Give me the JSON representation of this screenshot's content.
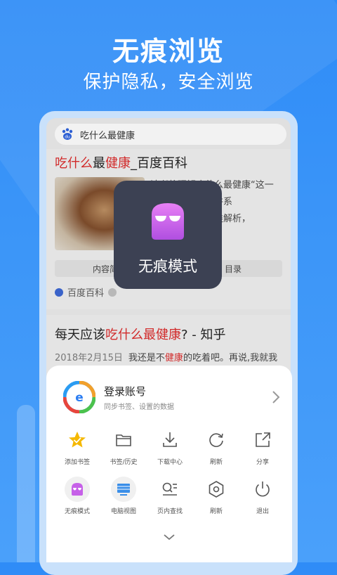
{
  "hero": {
    "headline": "无痕浏览",
    "subline": "保护隐私，安全浏览"
  },
  "search": {
    "query": "吃什么最健康"
  },
  "result1": {
    "title_a": "吃什么",
    "title_b": "最",
    "title_c": "健康",
    "title_d": "_百度百科",
    "snippet_lines": [
      "读者将理解吃什么最健康“这一",
      "问题展开论述，并系",
      "统地做了食物分类解析，",
      "对常见疾病做了..."
    ],
    "pills": [
      "内容简介",
      "目录"
    ],
    "source": "百度百科"
  },
  "result2": {
    "title_a": "每天应该",
    "title_b": "吃什么最健康",
    "title_c": "? - 知乎",
    "date": "2018年2月15日",
    "text_a": "我还是不",
    "text_b": "健康",
    "text_c": "的吃着吧。再说,我就我"
  },
  "toast": {
    "label": "无痕模式",
    "icon": "incognito-mask-icon"
  },
  "account": {
    "name": "登录账号",
    "desc": "同步书签、设置的数据"
  },
  "menu_row1": [
    {
      "label": "添加书签",
      "icon": "star-icon"
    },
    {
      "label": "书签/历史",
      "icon": "folder-icon"
    },
    {
      "label": "下载中心",
      "icon": "download-icon"
    },
    {
      "label": "刷新",
      "icon": "refresh-icon"
    },
    {
      "label": "分享",
      "icon": "share-icon"
    }
  ],
  "menu_row2": [
    {
      "label": "无痕模式",
      "icon": "incognito-icon"
    },
    {
      "label": "电脑视图",
      "icon": "desktop-view-icon"
    },
    {
      "label": "页内查找",
      "icon": "find-in-page-icon"
    },
    {
      "label": "刷新",
      "icon": "settings-hex-icon"
    },
    {
      "label": "退出",
      "icon": "power-icon"
    }
  ],
  "colors": {
    "accent": "#2f8cf7",
    "highlight": "#d12a2a",
    "toast_bg": "#3c4153",
    "star": "#f5b800"
  }
}
